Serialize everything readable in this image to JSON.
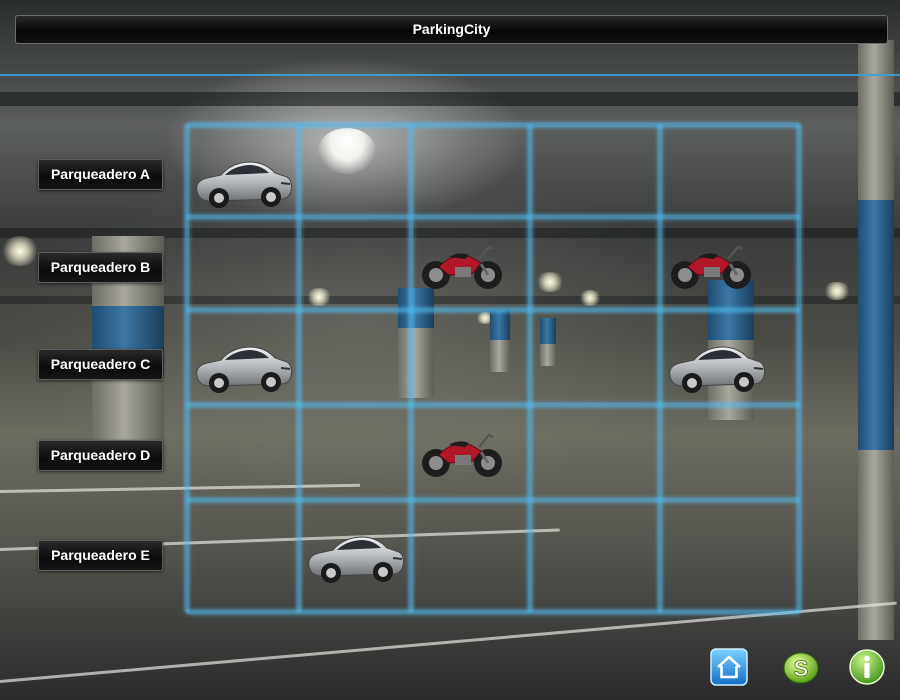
{
  "app": {
    "title": "ParkingCity"
  },
  "rows": [
    {
      "label": "Parqueadero A",
      "slots": [
        "car",
        "empty",
        "empty",
        "empty",
        "empty"
      ]
    },
    {
      "label": "Parqueadero B",
      "slots": [
        "empty",
        "empty",
        "motorcycle",
        "empty",
        "motorcycle"
      ]
    },
    {
      "label": "Parqueadero C",
      "slots": [
        "car",
        "empty",
        "empty",
        "empty",
        "car"
      ]
    },
    {
      "label": "Parqueadero D",
      "slots": [
        "empty",
        "empty",
        "motorcycle",
        "empty",
        "empty"
      ]
    },
    {
      "label": "Parqueadero E",
      "slots": [
        "empty",
        "car",
        "empty",
        "empty",
        "empty"
      ]
    }
  ],
  "toolbar": [
    {
      "icon": "home-icon"
    },
    {
      "icon": "skype-icon"
    },
    {
      "icon": "info-icon"
    }
  ],
  "colors": {
    "accent": "#3d9fd6",
    "grid": "#50bef0",
    "car": "#b9bcbf",
    "motorcycle": "#b0182a"
  }
}
